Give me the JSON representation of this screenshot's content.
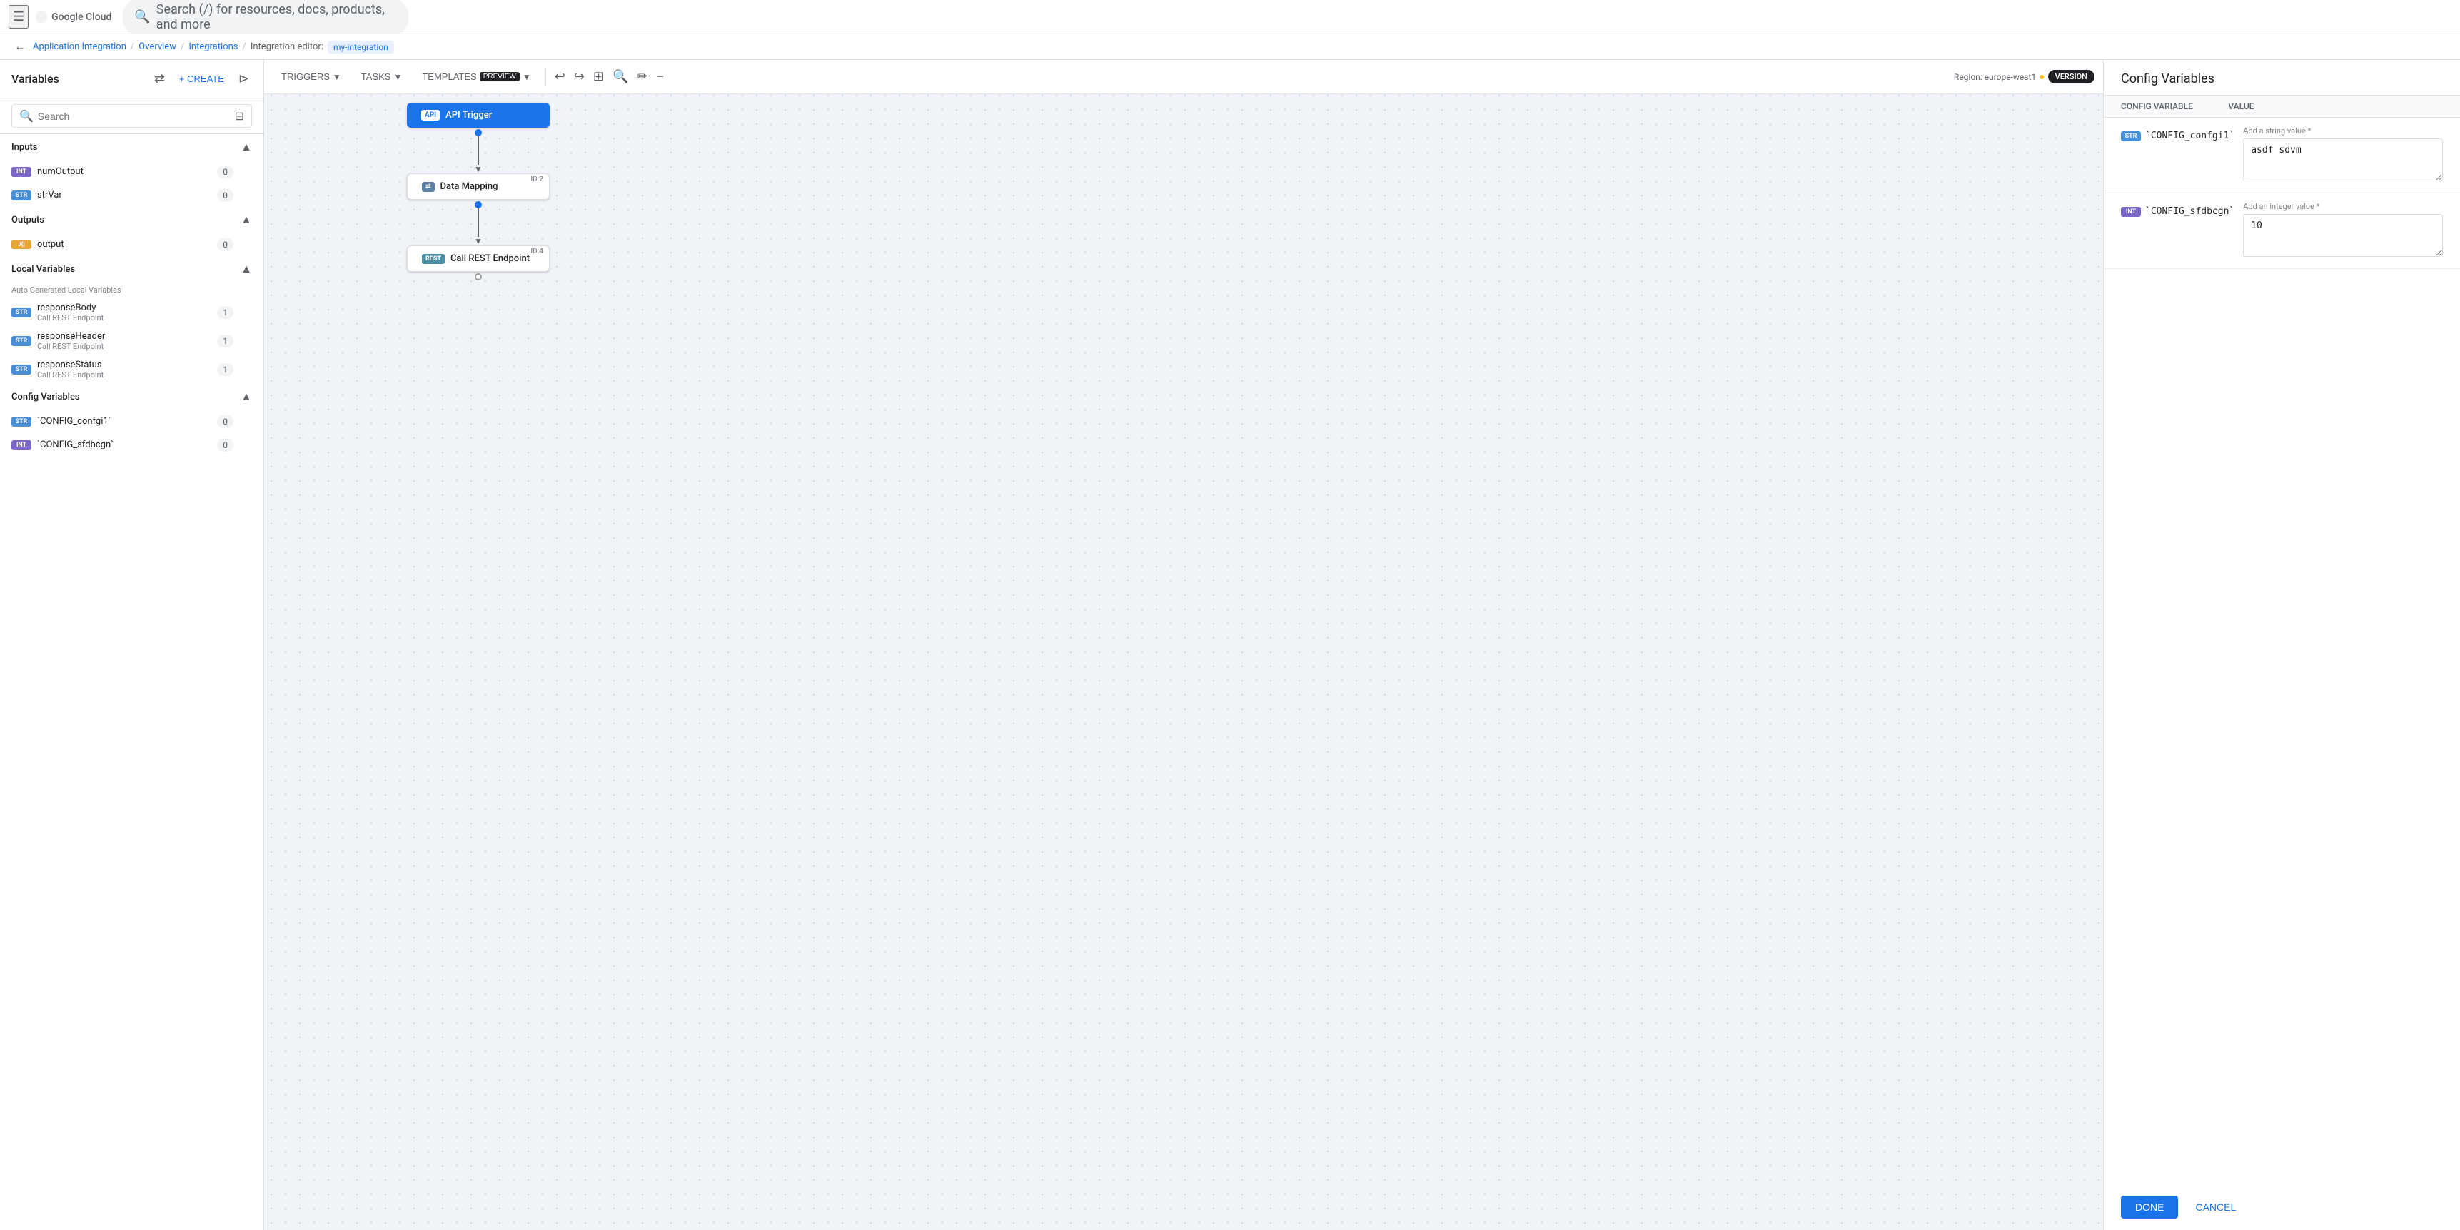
{
  "topbar": {
    "logo": "Google Cloud",
    "search_placeholder": "Search (/) for resources, docs, products, and more"
  },
  "breadcrumb": {
    "app_integration": "Application Integration",
    "overview": "Overview",
    "integrations": "Integrations",
    "integration_editor": "Integration editor:",
    "integration_name": "my-integration"
  },
  "left_panel": {
    "title": "Variables",
    "create_label": "+ CREATE",
    "search_placeholder": "Search",
    "inputs_section": {
      "label": "Inputs",
      "items": [
        {
          "type": "INT",
          "name": "numOutput",
          "count": "0"
        },
        {
          "type": "STR",
          "name": "strVar",
          "count": "0"
        }
      ]
    },
    "outputs_section": {
      "label": "Outputs",
      "items": [
        {
          "type": "JSON",
          "name": "output",
          "count": "0"
        }
      ]
    },
    "local_variables_section": {
      "label": "Local Variables",
      "sub_label": "Auto Generated Local Variables",
      "items": [
        {
          "type": "STR",
          "name": "responseBody",
          "sub": "Call REST Endpoint",
          "count": "1"
        },
        {
          "type": "STR",
          "name": "responseHeader",
          "sub": "Call REST Endpoint",
          "count": "1"
        },
        {
          "type": "STR",
          "name": "responseStatus",
          "sub": "Call REST Endpoint",
          "count": "1"
        }
      ]
    },
    "config_variables_section": {
      "label": "Config Variables",
      "items": [
        {
          "type": "STR",
          "name": "`CONFIG_confgi1`",
          "count": "0"
        },
        {
          "type": "INT",
          "name": "`CONFIG_sfdbcgn`",
          "count": "0"
        }
      ]
    }
  },
  "canvas": {
    "region_label": "Region: europe-west1",
    "version_label": "VERSION",
    "triggers_label": "TRIGGERS",
    "tasks_label": "TASKS",
    "templates_label": "TEMPLATES",
    "preview_label": "PREVIEW",
    "flow_nodes": [
      {
        "id": "api",
        "badge": "API",
        "label": "API Trigger"
      },
      {
        "id": "data",
        "badge": "DATA MAP",
        "label": "Data Mapping",
        "node_id": "ID:2"
      },
      {
        "id": "rest",
        "badge": "REST",
        "label": "Call REST Endpoint",
        "node_id": "ID:4"
      }
    ]
  },
  "right_panel": {
    "title": "Config Variables",
    "col_name": "Config Variable",
    "col_value": "Value",
    "rows": [
      {
        "type": "STR",
        "name": "`CONFIG_confgi1`",
        "value_placeholder": "Add a string value *",
        "value": "asdf sdvm"
      },
      {
        "type": "INT",
        "name": "`CONFIG_sfdbcgn`",
        "value_placeholder": "Add an integer value *",
        "value": "10"
      }
    ],
    "done_label": "DONE",
    "cancel_label": "CANCEL"
  }
}
